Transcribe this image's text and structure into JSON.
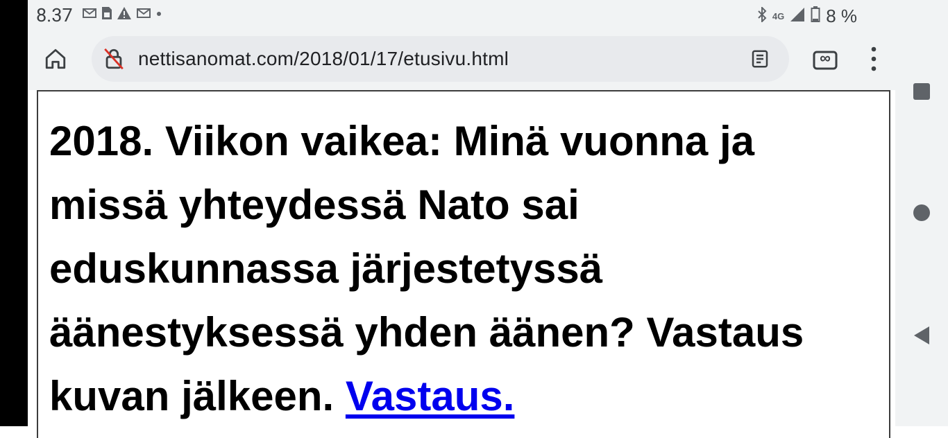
{
  "status_bar": {
    "time": "8.37",
    "battery": "8 %",
    "left_icons": [
      "gmail-icon",
      "sim-card-icon",
      "warning-icon",
      "gmail-icon",
      "dot-icon"
    ],
    "right_icons": [
      "bluetooth-icon",
      "4g-icon",
      "signal-icon",
      "battery-icon"
    ],
    "network": "4G"
  },
  "toolbar": {
    "url": "nettisanomat.com/2018/01/17/etusivu.html",
    "icons": [
      "home-icon",
      "insecure-lock-icon",
      "reader-mode-icon",
      "tab-switcher-icon",
      "more-vert-icon"
    ],
    "tab_count": "∞"
  },
  "article": {
    "headline": "2018. Viikon vaikea: Minä vuonna ja missä yhteydessä Nato sai eduskunnassa järjestetyssä äänestyksessä yhden äänen? Vastaus kuvan jälkeen.",
    "link_text": "Vastaus."
  },
  "navigation": {
    "icons": [
      "recents-icon",
      "home-circle-icon",
      "back-icon"
    ]
  }
}
